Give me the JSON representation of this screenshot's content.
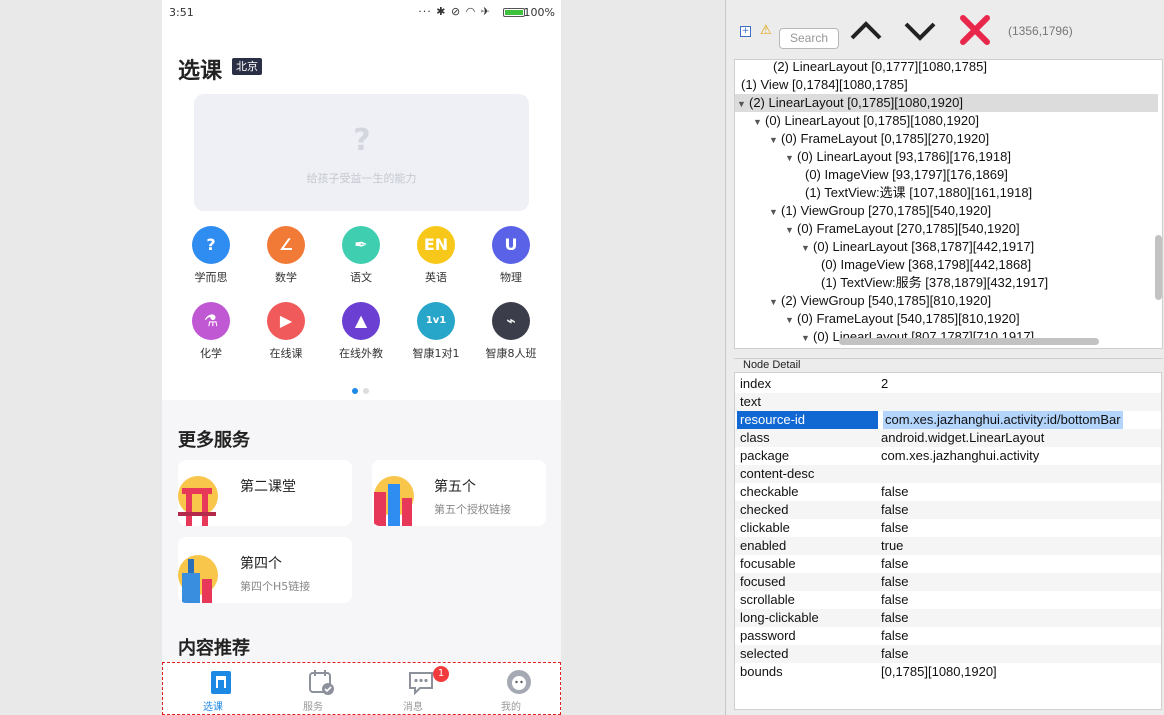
{
  "phone": {
    "status_time": "3:51",
    "status_icons": "··· ✱ ⊘ ◠ ✈",
    "battery_pct": "100%",
    "title": "选课",
    "city": "北京",
    "banner_tagline": "给孩子受益一生的能力",
    "categories": [
      {
        "label": "学而思",
        "icon": "question-icon",
        "glyph": "?",
        "color": "#2f8cf0"
      },
      {
        "label": "数学",
        "icon": "protractor-icon",
        "glyph": "∠",
        "color": "#f27a37"
      },
      {
        "label": "语文",
        "icon": "pen-nib-icon",
        "glyph": "✒",
        "color": "#3fcfb0"
      },
      {
        "label": "英语",
        "icon": "en-icon",
        "glyph": "EN",
        "color": "#f7c81a"
      },
      {
        "label": "物理",
        "icon": "magnet-icon",
        "glyph": "U",
        "color": "#5a63e8"
      },
      {
        "label": "化学",
        "icon": "flask-icon",
        "glyph": "⚗",
        "color": "#c058d4"
      },
      {
        "label": "在线课",
        "icon": "play-screen-icon",
        "glyph": "▶",
        "color": "#f05a5a"
      },
      {
        "label": "在线外教",
        "icon": "presentation-icon",
        "glyph": "▲",
        "color": "#6b3fd1"
      },
      {
        "label": "智康1对1",
        "icon": "one-on-one-icon",
        "glyph": "1v1",
        "color": "#27a6c9"
      },
      {
        "label": "智康8人班",
        "icon": "class-board-icon",
        "glyph": "⌁",
        "color": "#3b3d4a"
      }
    ],
    "more_services_title": "更多服务",
    "services": [
      {
        "name": "第二课堂",
        "desc": ""
      },
      {
        "name": "第五个",
        "desc": "第五个授权链接"
      },
      {
        "name": "第四个",
        "desc": "第四个H5链接"
      }
    ],
    "recommend_title": "内容推荐",
    "tabs": [
      {
        "label": "选课",
        "icon": "course-book-icon",
        "active": true
      },
      {
        "label": "服务",
        "icon": "calendar-check-icon",
        "active": false
      },
      {
        "label": "消息",
        "icon": "chat-bubble-icon",
        "active": false,
        "badge": "1"
      },
      {
        "label": "我的",
        "icon": "user-avatar-icon",
        "active": false
      }
    ]
  },
  "inspector": {
    "search_placeholder": "Search",
    "coords": "(1356,1796)",
    "tree": [
      {
        "indent": 2,
        "arrow": "",
        "text": "(2) LinearLayout [0,1777][1080,1785]"
      },
      {
        "indent": 0,
        "arrow": "",
        "text": "(1) View [0,1784][1080,1785]"
      },
      {
        "indent": 0,
        "arrow": "▼",
        "text": "(2) LinearLayout [0,1785][1080,1920]",
        "selected": true
      },
      {
        "indent": 1,
        "arrow": "▼",
        "text": "(0) LinearLayout [0,1785][1080,1920]"
      },
      {
        "indent": 2,
        "arrow": "▼",
        "text": "(0) FrameLayout [0,1785][270,1920]"
      },
      {
        "indent": 3,
        "arrow": "▼",
        "text": "(0) LinearLayout [93,1786][176,1918]"
      },
      {
        "indent": 4,
        "arrow": "",
        "text": "(0) ImageView [93,1797][176,1869]"
      },
      {
        "indent": 4,
        "arrow": "",
        "text": "(1) TextView:选课 [107,1880][161,1918]"
      },
      {
        "indent": 2,
        "arrow": "▼",
        "text": "(1) ViewGroup [270,1785][540,1920]"
      },
      {
        "indent": 3,
        "arrow": "▼",
        "text": "(0) FrameLayout [270,1785][540,1920]"
      },
      {
        "indent": 4,
        "arrow": "▼",
        "text": "(0) LinearLayout [368,1787][442,1917]"
      },
      {
        "indent": 5,
        "arrow": "",
        "text": "(0) ImageView [368,1798][442,1868]"
      },
      {
        "indent": 5,
        "arrow": "",
        "text": "(1) TextView:服务 [378,1879][432,1917]"
      },
      {
        "indent": 2,
        "arrow": "▼",
        "text": "(2) ViewGroup [540,1785][810,1920]"
      },
      {
        "indent": 3,
        "arrow": "▼",
        "text": "(0) FrameLayout [540,1785][810,1920]"
      },
      {
        "indent": 4,
        "arrow": "▼",
        "text": "(0) LinearLayout [807,1787][710,1917]"
      }
    ],
    "detail_title": "Node Detail",
    "details": [
      {
        "key": "index",
        "value": "2"
      },
      {
        "key": "text",
        "value": ""
      },
      {
        "key": "resource-id",
        "value": "com.xes.jazhanghui.activity:id/bottomBar",
        "selected": true
      },
      {
        "key": "class",
        "value": "android.widget.LinearLayout"
      },
      {
        "key": "package",
        "value": "com.xes.jazhanghui.activity"
      },
      {
        "key": "content-desc",
        "value": ""
      },
      {
        "key": "checkable",
        "value": "false"
      },
      {
        "key": "checked",
        "value": "false"
      },
      {
        "key": "clickable",
        "value": "false"
      },
      {
        "key": "enabled",
        "value": "true"
      },
      {
        "key": "focusable",
        "value": "false"
      },
      {
        "key": "focused",
        "value": "false"
      },
      {
        "key": "scrollable",
        "value": "false"
      },
      {
        "key": "long-clickable",
        "value": "false"
      },
      {
        "key": "password",
        "value": "false"
      },
      {
        "key": "selected",
        "value": "false"
      },
      {
        "key": "bounds",
        "value": "[0,1785][1080,1920]"
      }
    ]
  }
}
